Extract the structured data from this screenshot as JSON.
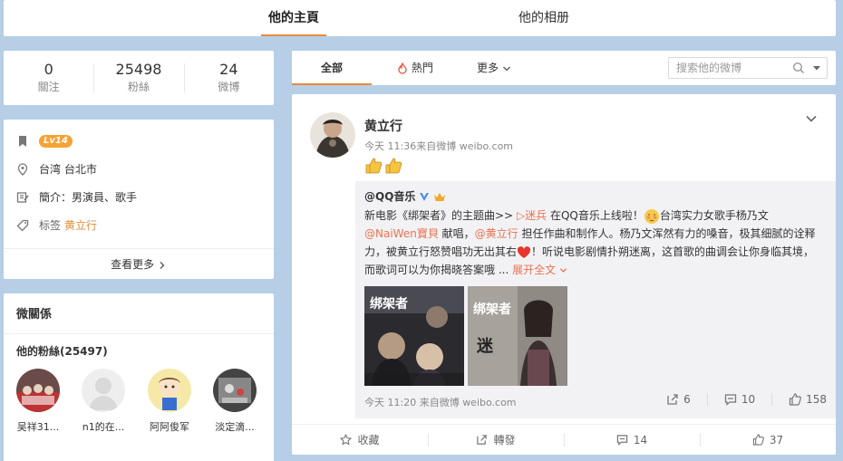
{
  "top_tabs": [
    {
      "label": "他的主頁",
      "active": true
    },
    {
      "label": "他的相册",
      "active": false
    }
  ],
  "stats": [
    {
      "value": "0",
      "label": "關注"
    },
    {
      "value": "25498",
      "label": "粉絲"
    },
    {
      "value": "24",
      "label": "微博"
    }
  ],
  "info": {
    "level": "Lv14",
    "location": "台湾 台北市",
    "intro": "簡介：男演員、歌手",
    "tag_label": "标签",
    "tag_value": "黄立行",
    "more": "查看更多"
  },
  "relations": {
    "title": "微關係",
    "fans_title": "他的粉絲(25497)",
    "fans": [
      {
        "name": "吴祥31..."
      },
      {
        "name": "n1的在..."
      },
      {
        "name": "阿阿俊军"
      },
      {
        "name": "淡定滴..."
      }
    ]
  },
  "filter": {
    "tabs": [
      {
        "label": "全部",
        "active": true
      },
      {
        "label": "熱門",
        "active": false
      },
      {
        "label": "更多",
        "active": false
      }
    ],
    "search_placeholder": "搜索他的微博"
  },
  "post": {
    "author": "黄立行",
    "meta": "今天 11:36来自微博 weibo.com",
    "repost": {
      "author": "@QQ音乐",
      "text_a": "新电影《绑架者》的主题曲>> ",
      "song_link": "▷迷兵",
      "text_b": "  在QQ音乐上线啦！",
      "text_c": "台湾实力女歌手杨乃文",
      "mention_1": "@NaiWen寶貝",
      "text_d": " 献唱，",
      "mention_2": "@黄立行",
      "text_e": " 担任作曲和制作人。杨乃文浑然有力的嗓音，极其细腻的诠释力，被黄立行怒赞唱功无出其右",
      "text_f": "！听说电影剧情扑朔迷离，这首歌的曲调会让你身临其境，而歌词可以为你揭晓答案哦 ...",
      "expand": "展开全文",
      "meta": "今天 11:20 来自微博 weibo.com",
      "repost_count": "6",
      "comment_count": "10",
      "like_count": "158"
    },
    "actions": {
      "favorite": "收藏",
      "forward": "轉發",
      "comment": "14",
      "like": "37"
    }
  },
  "colors": {
    "background": "#b6cfe6",
    "accent": "#e98a3a",
    "link": "#eb7350"
  }
}
